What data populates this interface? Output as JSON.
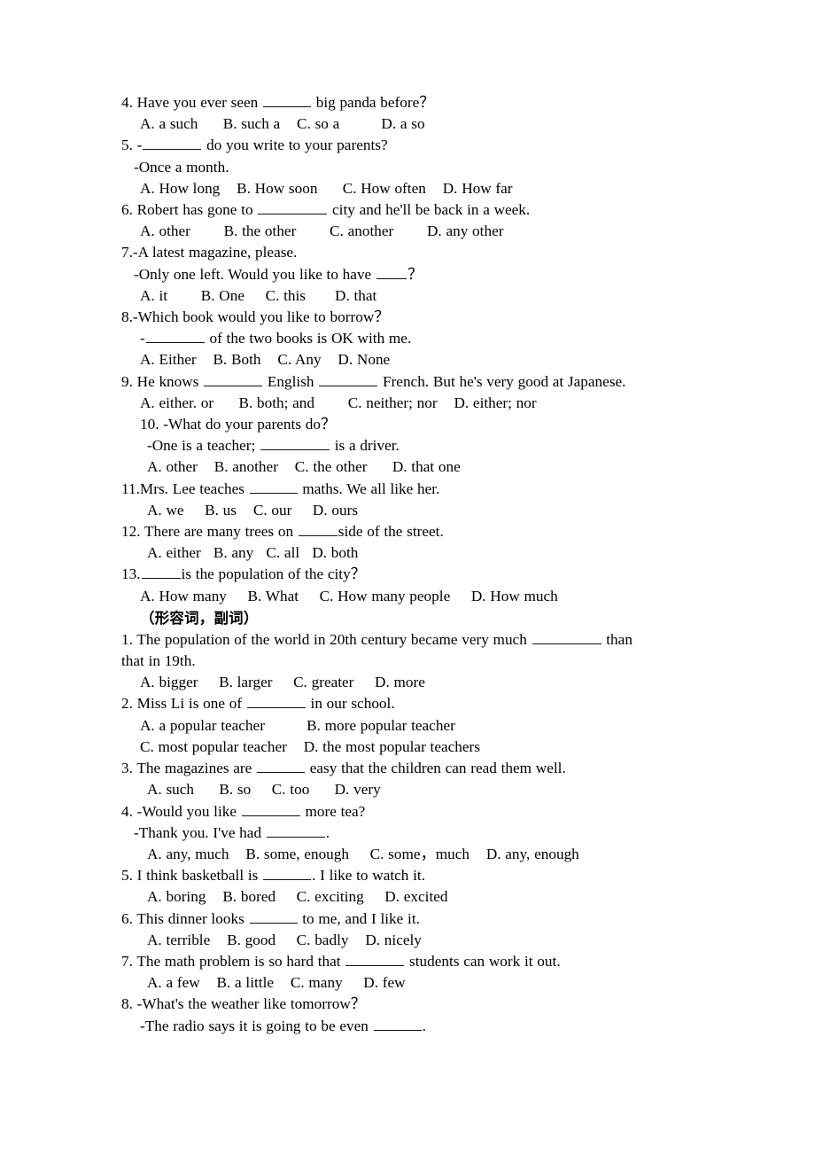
{
  "document": {
    "title": "English Grammar Multiple-Choice Exercise",
    "page_background": "#ffffff",
    "text_color": "#000000"
  },
  "sections": [
    {
      "id": "pronouns-determiners",
      "heading": null,
      "questions": [
        {
          "number": "4.",
          "stem_before": "4. Have you ever seen ",
          "stem_after": " big panda before？",
          "blank": "b-md",
          "options_line": "A. a such      B. such a    C. so a          D. a so"
        },
        {
          "number": "5.",
          "stem_before": "5. -",
          "stem_after": " do you write to your parents?",
          "blank": "b-lg",
          "dialogue": "-Once a month.",
          "options_line": "A. How long    B. How soon      C. How often    D. How far"
        },
        {
          "number": "6.",
          "stem_before": "6. Robert has gone to ",
          "stem_after": " city and he'll be back in a week.",
          "blank": "b-xl",
          "options_line": "A. other        B. the other        C. another        D. any other"
        },
        {
          "number": "7.",
          "stem_text": "7.-A latest magazine, please.",
          "dialogue_before": "-Only one left. Would you like to have ",
          "dialogue_after": "？",
          "blank": "b-xs",
          "options_line": "A. it        B. One     C. this       D. that"
        },
        {
          "number": "8.",
          "stem_text": "8.-Which book would you like to borrow？",
          "dialogue_before": "-",
          "dialogue_after": " of the two books is OK with me.",
          "blank": "b-lg",
          "options_line": "A. Either    B. Both    C. Any    D. None"
        },
        {
          "number": "9.",
          "stem_before": "9. He knows ",
          "stem_middle": " English ",
          "stem_after": " French. But he's very good at Japanese.",
          "blank1": "b-lg",
          "blank2": "b-lg",
          "options_line": "A. either. or      B. both; and        C. neither; nor    D. either; nor"
        },
        {
          "number": "10.",
          "stem_text": "10. -What do your parents do？",
          "dialogue_before": "-One is a teacher; ",
          "dialogue_after": " is a driver.",
          "blank": "b-xl",
          "options_line": "A. other    B. another    C. the other      D. that one"
        },
        {
          "number": "11.",
          "stem_before": "11.Mrs. Lee teaches ",
          "stem_after": " maths. We all like her.",
          "blank": "b-md",
          "options_line": "A. we     B. us    C. our     D. ours"
        },
        {
          "number": "12.",
          "stem_before": "12. There are many trees on ",
          "stem_after": "side of the street.",
          "blank": "b-sm",
          "options_line": "A. either   B. any   C. all   D. both"
        },
        {
          "number": "13.",
          "stem_before": "13.",
          "stem_after": "is the population of the city？",
          "blank": "b-sm",
          "options_line": "A. How many     B. What     C. How many people     D. How much"
        }
      ]
    },
    {
      "id": "adjectives-adverbs",
      "heading": "（形容词，副词）",
      "questions": [
        {
          "number": "1.",
          "stem_before": "1. The population of the world in 20th century became very much ",
          "stem_after": " than",
          "blank": "b-xl",
          "wrapped": "that in 19th.",
          "options_line": "A. bigger     B. larger     C. greater     D. more"
        },
        {
          "number": "2.",
          "stem_before": "2. Miss Li is one of ",
          "stem_after": " in our school.",
          "blank": "b-lg",
          "options_line_1": "A. a popular teacher          B. more popular teacher",
          "options_line_2": "C. most popular teacher    D. the most popular teachers"
        },
        {
          "number": "3.",
          "stem_before": "3. The magazines are ",
          "stem_after": " easy that the children can read them well.",
          "blank": "b-md",
          "options_line": "A. such      B. so     C. too      D. very"
        },
        {
          "number": "4.",
          "stem_before": "4. -Would you like ",
          "stem_after": " more tea?",
          "blank": "b-lg",
          "dialogue_before": "-Thank you. I've had ",
          "dialogue_after": ".",
          "blank2": "b-lg",
          "options_line": "A. any, much    B. some, enough     C. some，much    D. any, enough"
        },
        {
          "number": "5.",
          "stem_before": "5. I think basketball is ",
          "stem_after": ". I like to watch it.",
          "blank": "b-md",
          "options_line": "A. boring    B. bored     C. exciting     D. excited"
        },
        {
          "number": "6.",
          "stem_before": "6. This dinner looks ",
          "stem_after": " to me, and I like it.",
          "blank": "b-md",
          "options_line": "A. terrible    B. good     C. badly    D. nicely"
        },
        {
          "number": "7.",
          "stem_before": "7. The math problem is so hard that ",
          "stem_after": " students can work it out.",
          "blank": "b-lg",
          "options_line": "A. a few    B. a little    C. many     D. few"
        },
        {
          "number": "8.",
          "stem_text": "8. -What's the weather like tomorrow？",
          "dialogue_before": "-The radio says it is going to be even ",
          "dialogue_after": ".",
          "blank": "b-md"
        }
      ]
    }
  ]
}
